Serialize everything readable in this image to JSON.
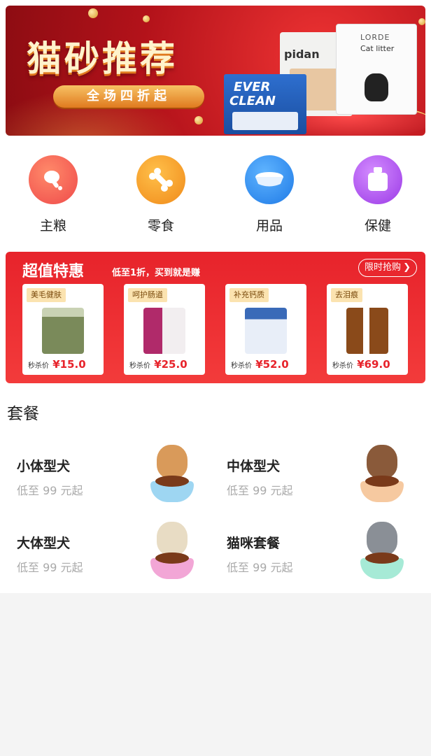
{
  "banner": {
    "title": "猫砂推荐",
    "subtitle": "全场四折起",
    "brand_pidan": "pidan",
    "brand_lorde": "LORDE",
    "lorde_sub": "Cat litter",
    "brand_ever1": "EVER",
    "brand_ever2": "CLEAN"
  },
  "categories": [
    {
      "label": "主粮",
      "color": "#ef4f4f",
      "icon": "drumstick-icon"
    },
    {
      "label": "零食",
      "color": "#f59a23",
      "icon": "bone-icon"
    },
    {
      "label": "用品",
      "color": "#2b8ef0",
      "icon": "bowl-icon"
    },
    {
      "label": "保健",
      "color": "#b355f0",
      "icon": "weight-icon"
    }
  ],
  "deal": {
    "title": "超值特惠",
    "subtitle": "低至1折，买到就是赚",
    "button": "限时抢购",
    "items": [
      {
        "tag": "美毛健肤",
        "price_label": "秒杀价",
        "price": "¥15.0",
        "color": "#7a8a5a"
      },
      {
        "tag": "呵护肠道",
        "price_label": "秒杀价",
        "price": "¥25.0",
        "color": "#b02a6a"
      },
      {
        "tag": "补充钙质",
        "price_label": "秒杀价",
        "price": "¥52.0",
        "color": "#3a6ab8"
      },
      {
        "tag": "去泪痕",
        "price_label": "秒杀价",
        "price": "¥69.0",
        "color": "#8a4a1a"
      }
    ]
  },
  "packages": {
    "title": "套餐",
    "items": [
      {
        "name": "小体型犬",
        "price": "低至 99 元起",
        "bowl": "#9ed6f2",
        "pet": "#d99a5a"
      },
      {
        "name": "中体型犬",
        "price": "低至 99 元起",
        "bowl": "#f6c9a0",
        "pet": "#8a5a3a"
      },
      {
        "name": "大体型犬",
        "price": "低至 99 元起",
        "bowl": "#f2a6d6",
        "pet": "#f0e6d0"
      },
      {
        "name": "猫咪套餐",
        "price": "低至 99 元起",
        "bowl": "#a6ead6",
        "pet": "#8a8f96"
      }
    ]
  }
}
